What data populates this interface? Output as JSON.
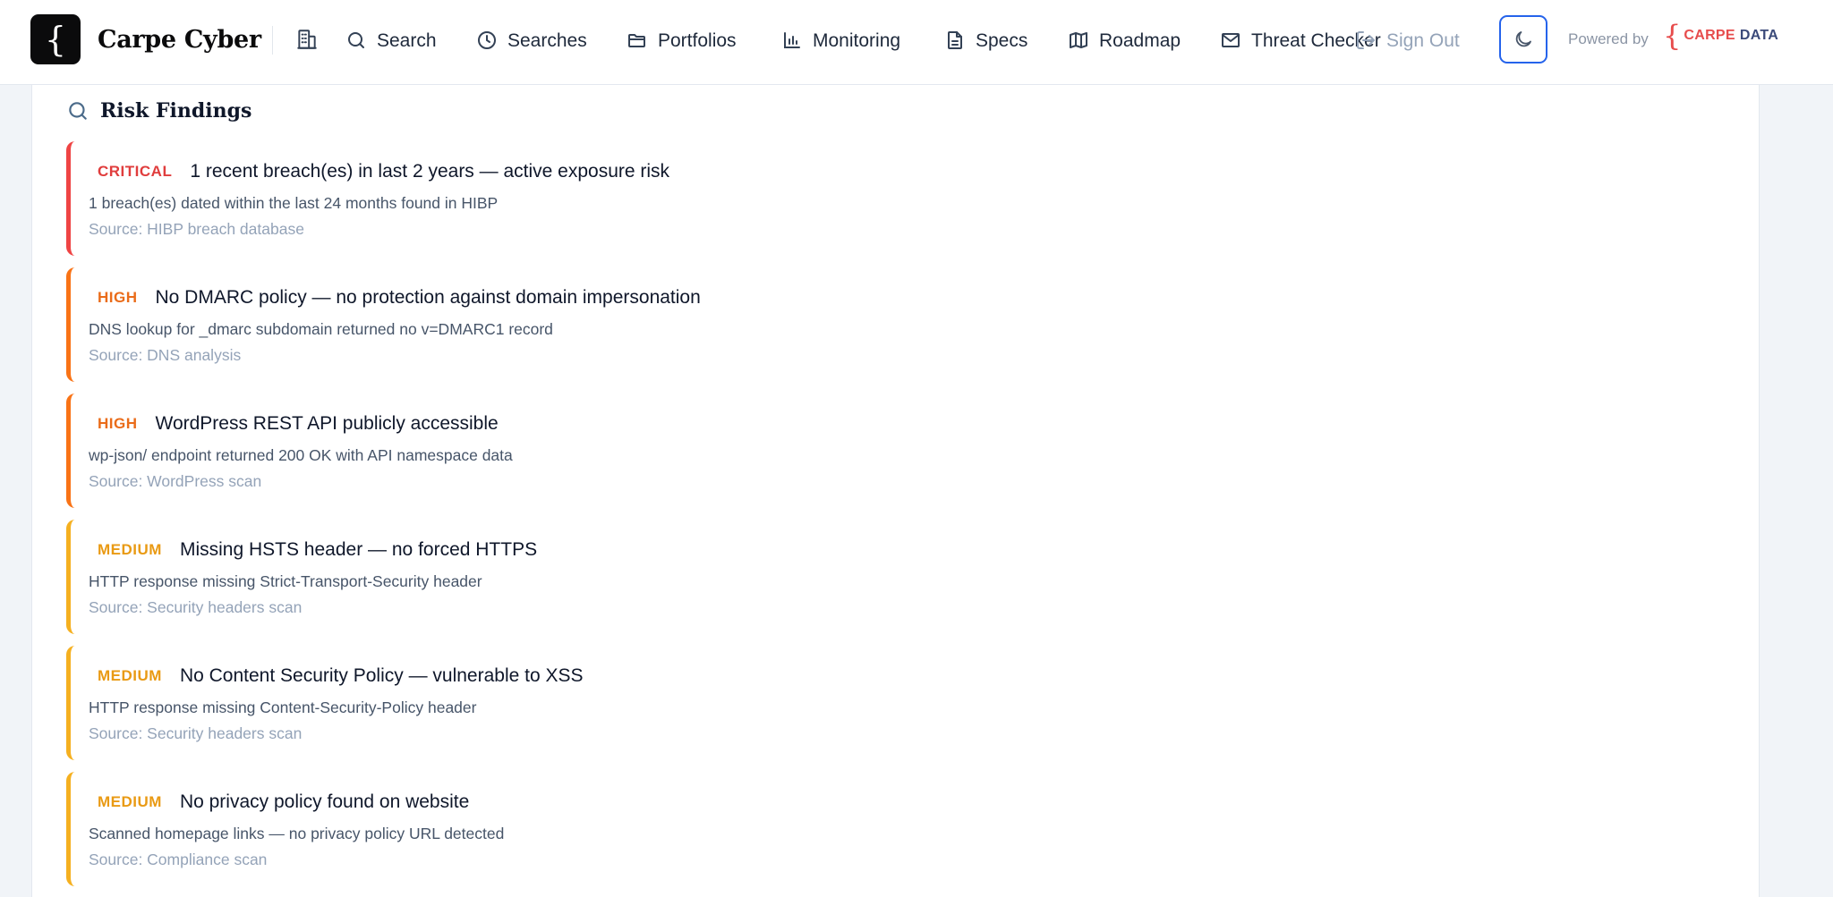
{
  "brand": {
    "logo_glyph": "{",
    "name": "Carpe Cyber"
  },
  "nav": {
    "items": [
      {
        "label": "Search",
        "icon": "search-icon"
      },
      {
        "label": "Searches",
        "icon": "clock-icon"
      },
      {
        "label": "Portfolios",
        "icon": "folder-icon"
      },
      {
        "label": "Monitoring",
        "icon": "bar-chart-icon"
      },
      {
        "label": "Specs",
        "icon": "document-icon"
      },
      {
        "label": "Roadmap",
        "icon": "map-icon"
      },
      {
        "label": "Threat Checker",
        "icon": "mail-icon"
      }
    ],
    "sign_out": "Sign Out",
    "powered_by": "Powered by",
    "partner_logo": {
      "part1": "CARPE",
      "part2": "DATA"
    }
  },
  "colors": {
    "critical": "#e03d3d",
    "high": "#ea6c1a",
    "medium": "#e99a14",
    "accent": "#2563eb"
  },
  "section": {
    "title": "Risk Findings",
    "icon": "search-icon"
  },
  "findings": [
    {
      "severity": "CRITICAL",
      "title": "1 recent breach(es) in last 2 years — active exposure risk",
      "description": "1 breach(es) dated within the last 24 months found in HIBP",
      "source": "Source: HIBP breach database"
    },
    {
      "severity": "HIGH",
      "title": "No DMARC policy — no protection against domain impersonation",
      "description": "DNS lookup for _dmarc subdomain returned no v=DMARC1 record",
      "source": "Source: DNS analysis"
    },
    {
      "severity": "HIGH",
      "title": "WordPress REST API publicly accessible",
      "description": "wp-json/ endpoint returned 200 OK with API namespace data",
      "source": "Source: WordPress scan"
    },
    {
      "severity": "MEDIUM",
      "title": "Missing HSTS header — no forced HTTPS",
      "description": "HTTP response missing Strict-Transport-Security header",
      "source": "Source: Security headers scan"
    },
    {
      "severity": "MEDIUM",
      "title": "No Content Security Policy — vulnerable to XSS",
      "description": "HTTP response missing Content-Security-Policy header",
      "source": "Source: Security headers scan"
    },
    {
      "severity": "MEDIUM",
      "title": "No privacy policy found on website",
      "description": "Scanned homepage links — no privacy policy URL detected",
      "source": "Source: Compliance scan"
    }
  ]
}
